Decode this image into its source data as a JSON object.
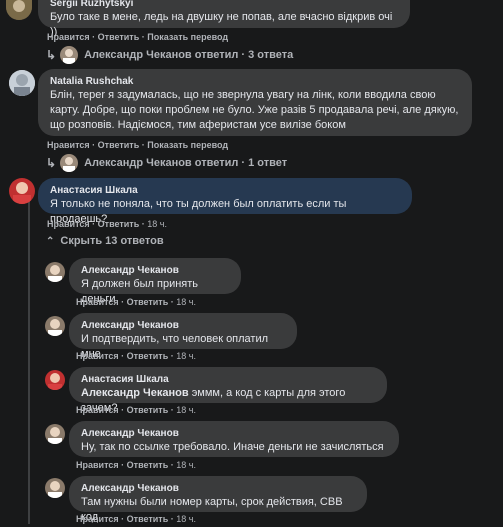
{
  "actions": {
    "like": "Нравится",
    "reply": "Ответить",
    "translate": "Показать перевод",
    "sep": "·"
  },
  "comments": [
    {
      "author": "Sergii Ruzhytskyi",
      "text": "Було таке в мене, ледь на двушку не попав, але вчасно відкрив очі ))",
      "reply_summary": {
        "name": "Александр Чеканов",
        "verb": "ответил",
        "count": "3 ответа"
      }
    },
    {
      "author": "Natalia Rushchak",
      "lines": [
        "Блін, теper я задумалась, що не звернула увагу на лінк, коли вводила свою",
        "карту. Добре, що поки проблем не було. Уже разів 5 продавала речі, але дякую,",
        "що розповів. Надіємося, тим аферистам усе вилізе боком"
      ],
      "reply_summary": {
        "name": "Александр Чеканов",
        "verb": "ответил",
        "count": "1 ответ"
      }
    },
    {
      "author": "Анастасия Шкала",
      "text": "Я только не поняла, что ты должен был оплатить если ты продаешь?",
      "time": "18 ч.",
      "toggle": "Скрыть 13 ответов"
    }
  ],
  "replies": [
    {
      "author": "Александр Чеканов",
      "text": "Я должен был принять деньги",
      "time": "18 ч."
    },
    {
      "author": "Александр Чеканов",
      "text": "И подтвердить, что человек оплатил мне",
      "time": "18 ч."
    },
    {
      "author": "Анастасия Шкала",
      "mention": "Александр Чеканов",
      "text": " эммм, а код с карты для этого зачем?",
      "time": "18 ч."
    },
    {
      "author": "Александр Чеканов",
      "text": "Ну, так по ссылке требовало. Иначе деньги не зачисляться",
      "time": "18 ч."
    },
    {
      "author": "Александр Чеканов",
      "text": "Там нужны были номер карты, срок действия, СВВ код",
      "time": "18 ч."
    }
  ]
}
